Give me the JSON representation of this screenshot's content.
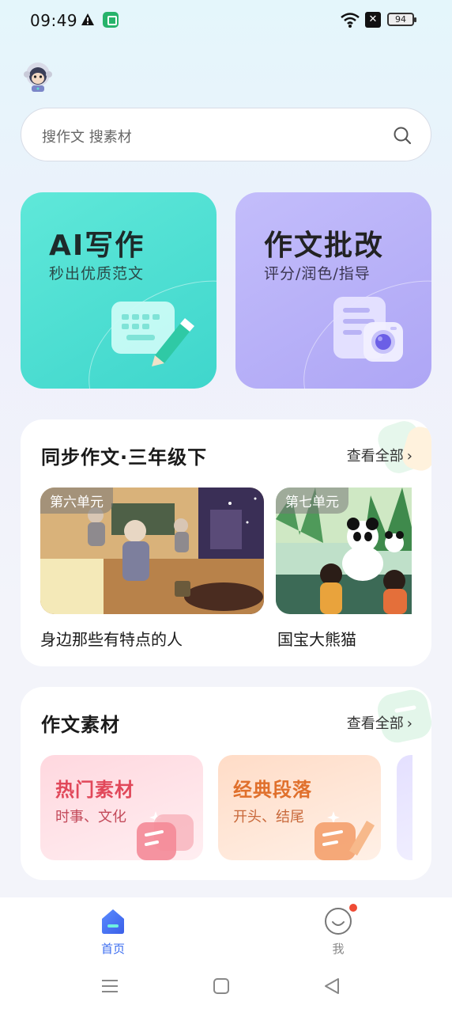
{
  "status": {
    "time": "09:49",
    "battery": "94"
  },
  "search": {
    "placeholder": "搜作文 搜素材"
  },
  "cards": {
    "ai": {
      "title": "AI写作",
      "subtitle": "秒出优质范文"
    },
    "correct": {
      "title": "作文批改",
      "subtitle": "评分/润色/指导"
    }
  },
  "sync": {
    "title": "同步作文·三年级下",
    "view_all": "查看全部",
    "units": [
      {
        "tag": "第六单元",
        "name": "身边那些有特点的人"
      },
      {
        "tag": "第七单元",
        "name": "国宝大熊猫"
      }
    ]
  },
  "materials": {
    "title": "作文素材",
    "view_all": "查看全部",
    "items": [
      {
        "title": "热门素材",
        "subtitle": "时事、文化"
      },
      {
        "title": "经典段落",
        "subtitle": "开头、结尾"
      }
    ]
  },
  "nav": {
    "home": "首页",
    "me": "我"
  },
  "colors": {
    "accent": "#3b6df0",
    "ai_card": "#45dcd0",
    "correct_card": "#b6aef8",
    "hot": "#e1485a",
    "classic": "#e0702c"
  }
}
